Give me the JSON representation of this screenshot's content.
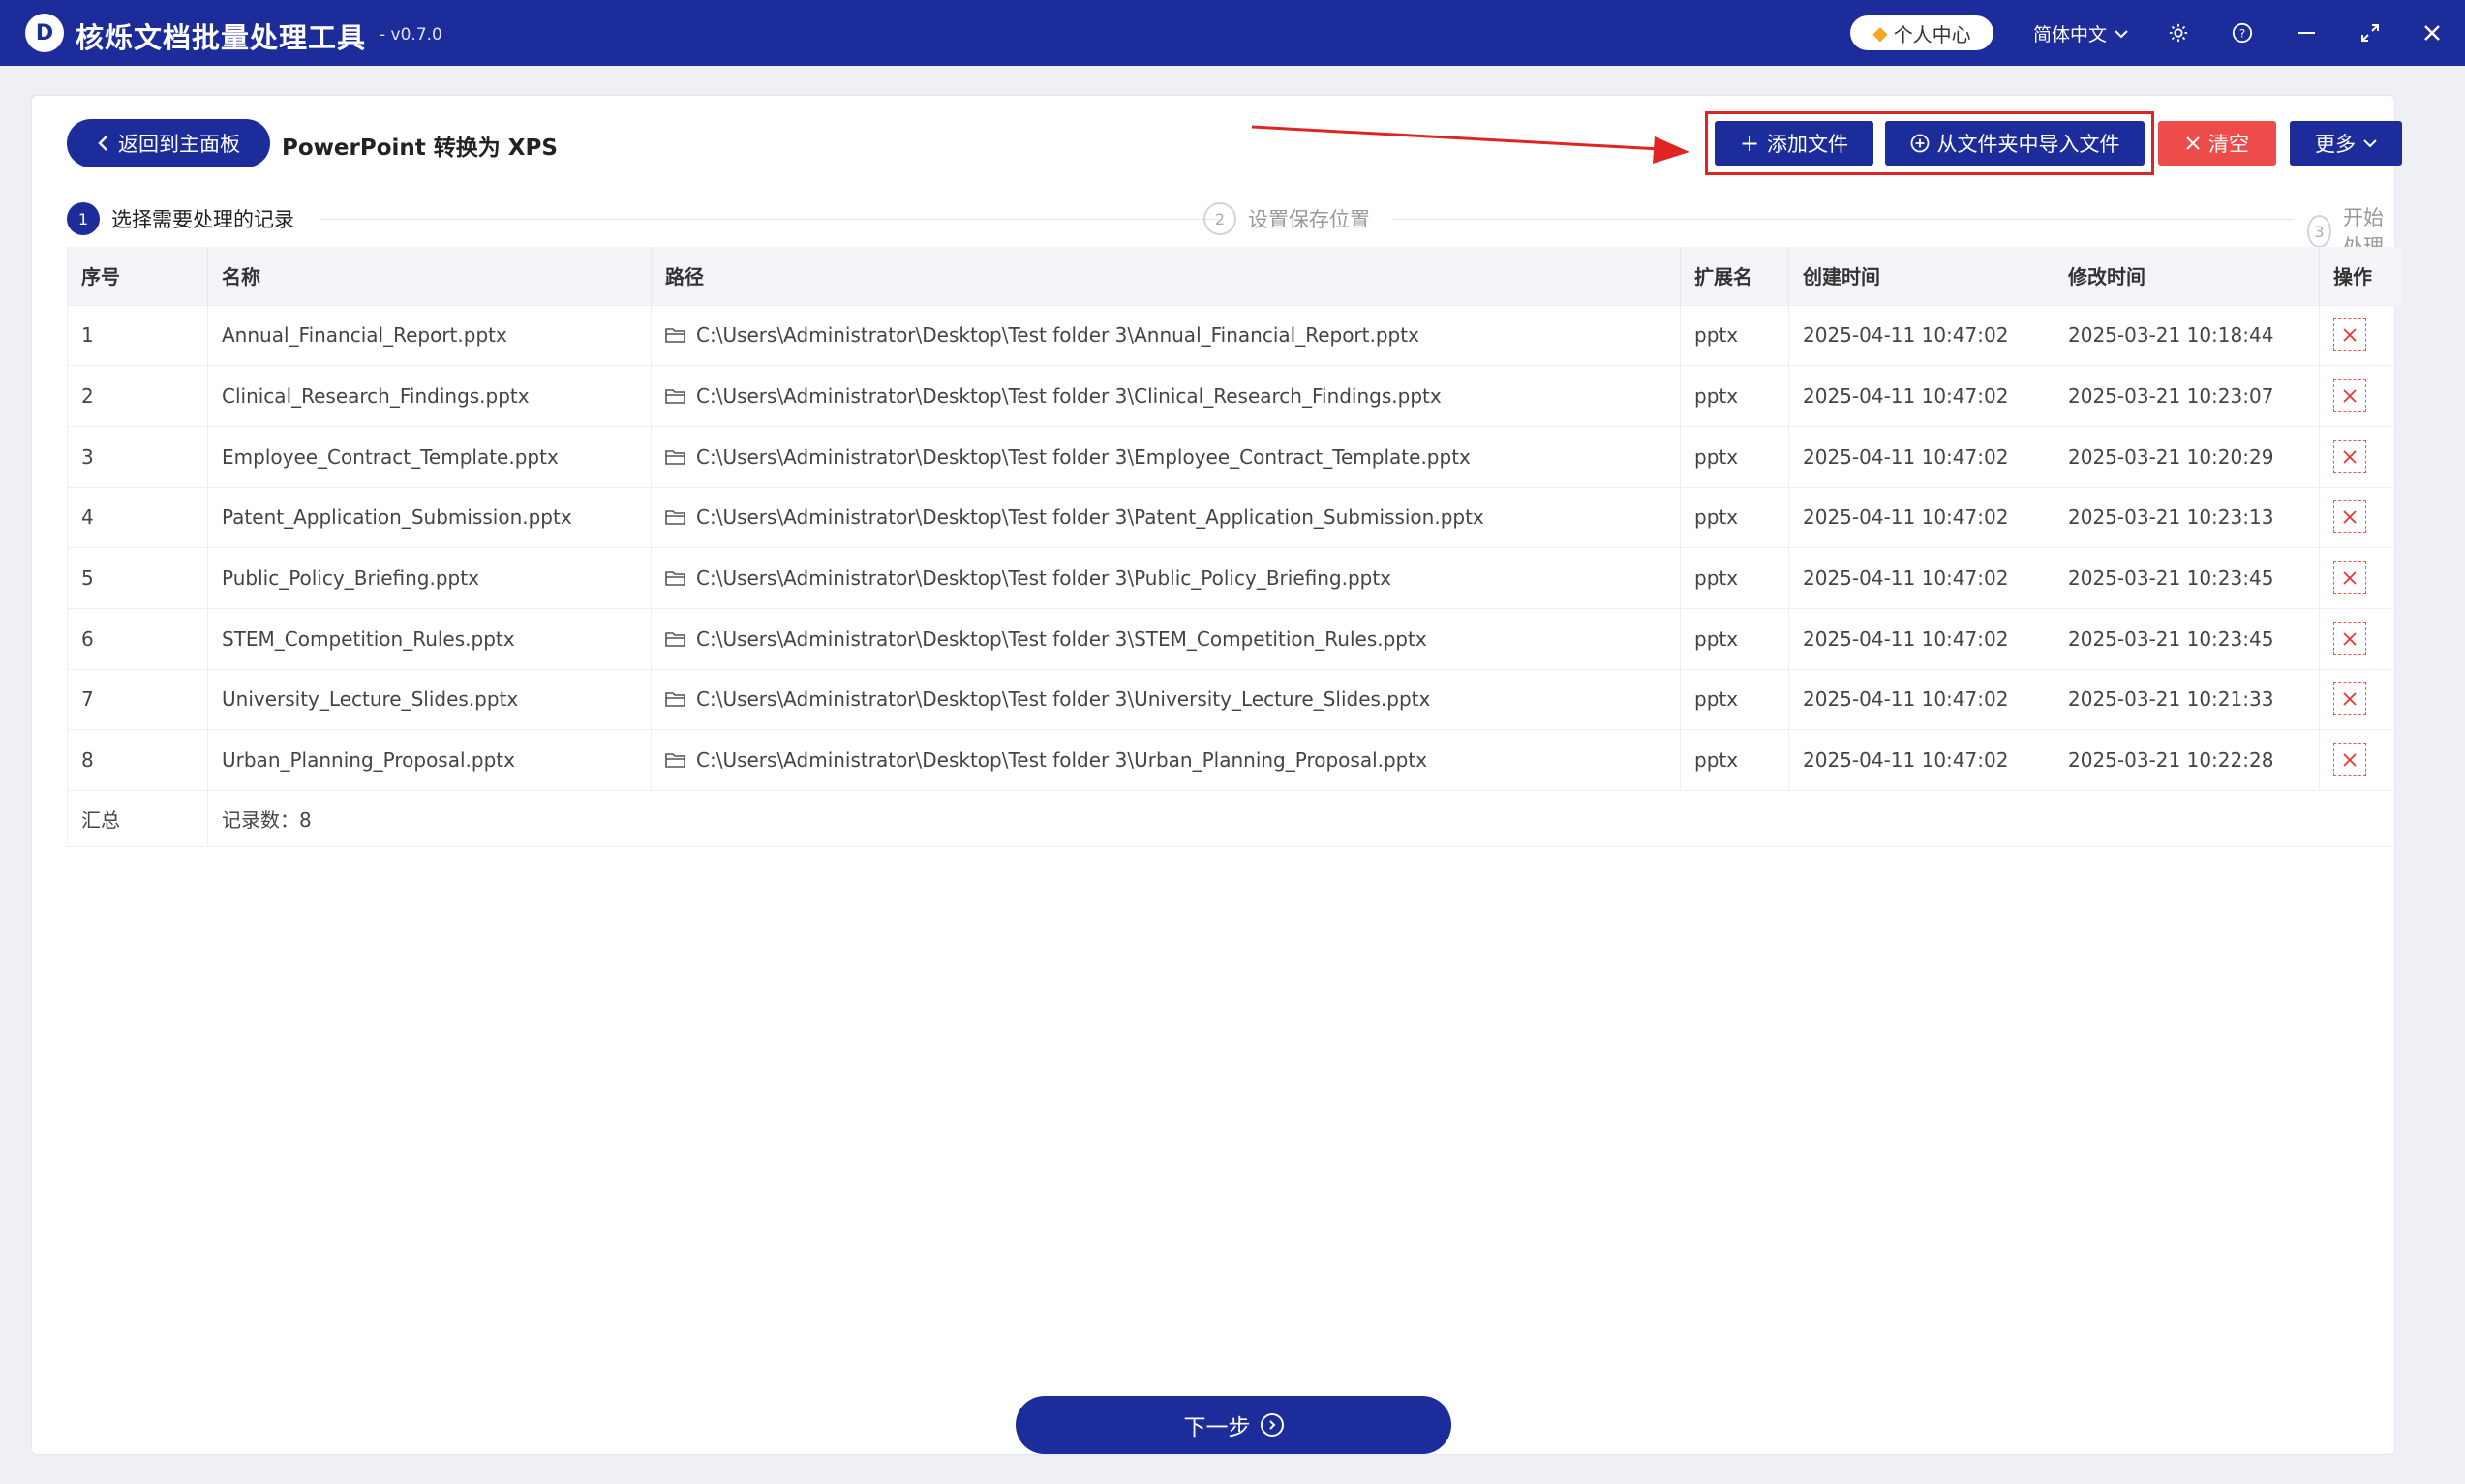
{
  "window": {
    "title": "核烁文档批量处理工具",
    "version": "- v0.7.0",
    "user_center": "个人中心",
    "language": "简体中文"
  },
  "header": {
    "back_label": "返回到主面板",
    "page_title": "PowerPoint 转换为 XPS",
    "add_file": "添加文件",
    "import_folder": "从文件夹中导入文件",
    "clear": "清空",
    "more": "更多"
  },
  "steps": [
    {
      "num": "1",
      "label": "选择需要处理的记录"
    },
    {
      "num": "2",
      "label": "设置保存位置"
    },
    {
      "num": "3",
      "label": "开始处理"
    }
  ],
  "table": {
    "columns": [
      "序号",
      "名称",
      "路径",
      "扩展名",
      "创建时间",
      "修改时间",
      "操作"
    ],
    "rows": [
      {
        "idx": "1",
        "name": "Annual_Financial_Report.pptx",
        "path": "C:\\Users\\Administrator\\Desktop\\Test folder 3\\Annual_Financial_Report.pptx",
        "ext": "pptx",
        "created": "2025-04-11 10:47:02",
        "modified": "2025-03-21 10:18:44"
      },
      {
        "idx": "2",
        "name": "Clinical_Research_Findings.pptx",
        "path": "C:\\Users\\Administrator\\Desktop\\Test folder 3\\Clinical_Research_Findings.pptx",
        "ext": "pptx",
        "created": "2025-04-11 10:47:02",
        "modified": "2025-03-21 10:23:07"
      },
      {
        "idx": "3",
        "name": "Employee_Contract_Template.pptx",
        "path": "C:\\Users\\Administrator\\Desktop\\Test folder 3\\Employee_Contract_Template.pptx",
        "ext": "pptx",
        "created": "2025-04-11 10:47:02",
        "modified": "2025-03-21 10:20:29"
      },
      {
        "idx": "4",
        "name": "Patent_Application_Submission.pptx",
        "path": "C:\\Users\\Administrator\\Desktop\\Test folder 3\\Patent_Application_Submission.pptx",
        "ext": "pptx",
        "created": "2025-04-11 10:47:02",
        "modified": "2025-03-21 10:23:13"
      },
      {
        "idx": "5",
        "name": "Public_Policy_Briefing.pptx",
        "path": "C:\\Users\\Administrator\\Desktop\\Test folder 3\\Public_Policy_Briefing.pptx",
        "ext": "pptx",
        "created": "2025-04-11 10:47:02",
        "modified": "2025-03-21 10:23:45"
      },
      {
        "idx": "6",
        "name": "STEM_Competition_Rules.pptx",
        "path": "C:\\Users\\Administrator\\Desktop\\Test folder 3\\STEM_Competition_Rules.pptx",
        "ext": "pptx",
        "created": "2025-04-11 10:47:02",
        "modified": "2025-03-21 10:23:45"
      },
      {
        "idx": "7",
        "name": "University_Lecture_Slides.pptx",
        "path": "C:\\Users\\Administrator\\Desktop\\Test folder 3\\University_Lecture_Slides.pptx",
        "ext": "pptx",
        "created": "2025-04-11 10:47:02",
        "modified": "2025-03-21 10:21:33"
      },
      {
        "idx": "8",
        "name": "Urban_Planning_Proposal.pptx",
        "path": "C:\\Users\\Administrator\\Desktop\\Test folder 3\\Urban_Planning_Proposal.pptx",
        "ext": "pptx",
        "created": "2025-04-11 10:47:02",
        "modified": "2025-03-21 10:22:28"
      }
    ],
    "summary_label": "汇总",
    "summary_value": "记录数：8"
  },
  "footer": {
    "next": "下一步"
  },
  "colors": {
    "primary": "#1c2c9b",
    "danger": "#ee4b4b",
    "highlight": "#e02424"
  }
}
